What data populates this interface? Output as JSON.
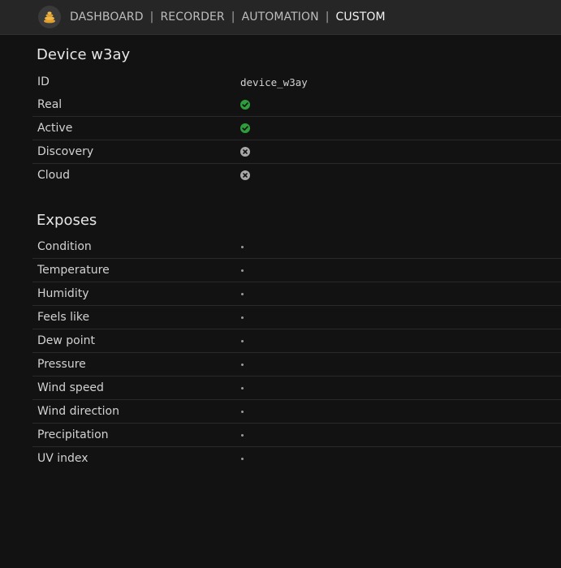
{
  "nav": {
    "links": [
      {
        "label": "DASHBOARD",
        "active": false
      },
      {
        "label": "RECORDER",
        "active": false
      },
      {
        "label": "AUTOMATION",
        "active": false
      },
      {
        "label": "CUSTOM",
        "active": true
      }
    ],
    "separator": "|",
    "logo_icon": "beehive-logo-icon"
  },
  "device": {
    "title": "Device w3ay",
    "rows": [
      {
        "label": "ID",
        "value": "device_w3ay"
      },
      {
        "label": "Real",
        "status": "yes"
      },
      {
        "label": "Active",
        "status": "yes"
      },
      {
        "label": "Discovery",
        "status": "no"
      },
      {
        "label": "Cloud",
        "status": "no"
      }
    ]
  },
  "exposes": {
    "title": "Exposes",
    "rows": [
      {
        "label": "Condition"
      },
      {
        "label": "Temperature"
      },
      {
        "label": "Humidity"
      },
      {
        "label": "Feels like"
      },
      {
        "label": "Dew point"
      },
      {
        "label": "Pressure"
      },
      {
        "label": "Wind speed"
      },
      {
        "label": "Wind direction"
      },
      {
        "label": "Precipitation"
      },
      {
        "label": "UV index"
      }
    ]
  },
  "colors": {
    "yes": "#2e9e3a",
    "no": "#a8a8a8",
    "background": "#121212",
    "topbar": "#262626"
  }
}
